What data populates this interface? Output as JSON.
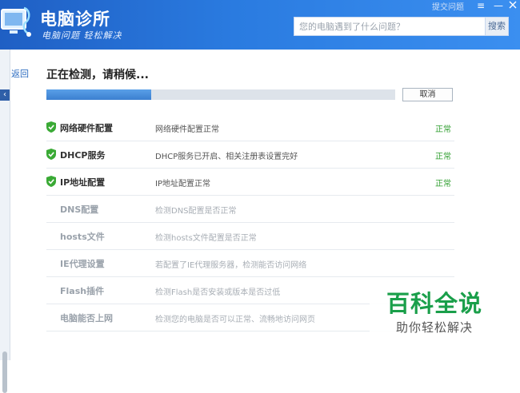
{
  "header": {
    "title": "电脑诊所",
    "slogan": "电脑问题 轻松解决",
    "search_placeholder": "您的电脑遇到了什么问题？",
    "search_button": "搜索",
    "feedback_link": "提交问题",
    "menu_icon": "≡",
    "minimize_icon": "—"
  },
  "nav": {
    "back": "返回"
  },
  "scan": {
    "status_title": "正在检测，请稍候...",
    "progress": 0.3,
    "cancel_label": "取消"
  },
  "checks": [
    {
      "name": "网络硬件配置",
      "desc": "网络硬件配置正常",
      "status": "正常",
      "done": true
    },
    {
      "name": "DHCP服务",
      "desc": "DHCP服务已开启、相关注册表设置完好",
      "status": "正常",
      "done": true
    },
    {
      "name": "IP地址配置",
      "desc": "IP地址配置正常",
      "status": "正常",
      "done": true
    },
    {
      "name": "DNS配置",
      "desc": "检测DNS配置是否正常",
      "status": "",
      "done": false
    },
    {
      "name": "hosts文件",
      "desc": "检测hosts文件配置是否正常",
      "status": "",
      "done": false
    },
    {
      "name": "IE代理设置",
      "desc": "若配置了IE代理服务器，检测能否访问网络",
      "status": "",
      "done": false
    },
    {
      "name": "Flash插件",
      "desc": "检测Flash是否安装或版本是否过低",
      "status": "",
      "done": false
    },
    {
      "name": "电脑能否上网",
      "desc": "检测您的电脑是否可以正常、流畅地访问网页",
      "status": "",
      "done": false
    }
  ],
  "watermark": {
    "title": "百科全说",
    "subtitle": "助你轻松解决"
  },
  "colors": {
    "header": "#2a7be0",
    "ok": "#2f9e2f",
    "progress": "#3b7fd0",
    "check": "#3aaa35"
  }
}
